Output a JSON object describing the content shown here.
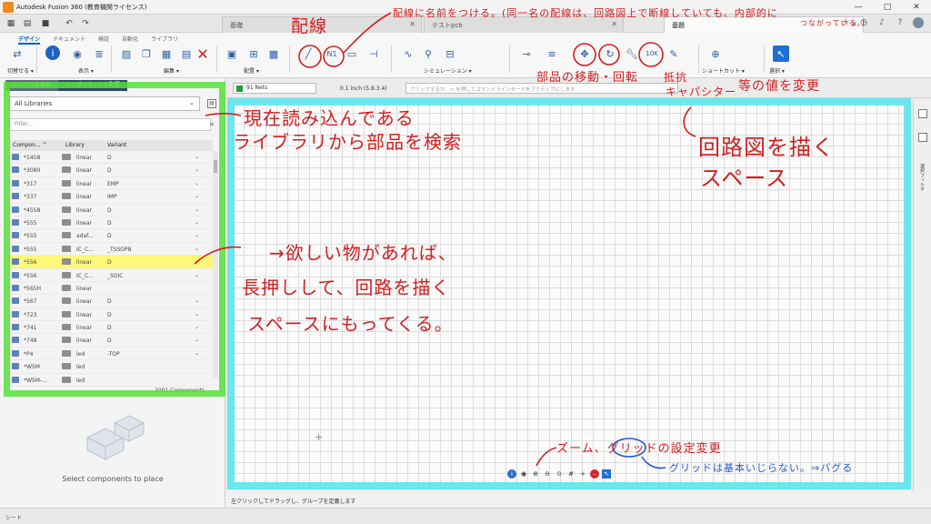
{
  "title_bar": {
    "title": "Autodesk Fusion 360 (教育機関ライセンス)",
    "controls": [
      "—",
      "□",
      "✕"
    ]
  },
  "doc_tabs": [
    {
      "label": "基礎",
      "active": false
    },
    {
      "label": "テストpcb",
      "active": false
    },
    {
      "label": "基題",
      "active": true
    }
  ],
  "ribbon": {
    "tabs": [
      "デザイン",
      "ドキュメント",
      "検証",
      "自動化",
      "ライブラリ"
    ],
    "groups": [
      "切替せる ▾",
      "表示 ▾",
      "編集 ▾",
      "配置 ▾",
      "シミュレーション ▾",
      "ショートカット ▾",
      "選択 ▾"
    ]
  },
  "left_panel": {
    "tabs": [
      "レイヤーを表示",
      "コンポーネントを配置"
    ],
    "library_select": "All Libraries",
    "filter_placeholder": "Filter...",
    "columns": {
      "component": "Compon... ^",
      "library": "Library",
      "variant": "Variant"
    },
    "rows": [
      {
        "component": "*1458",
        "library": "linear",
        "variant": "D",
        "highlight": false
      },
      {
        "component": "*3080",
        "library": "linear",
        "variant": "D",
        "highlight": false
      },
      {
        "component": "*317",
        "library": "linear",
        "variant": "EMP",
        "highlight": false
      },
      {
        "component": "*337",
        "library": "linear",
        "variant": "IMP",
        "highlight": false
      },
      {
        "component": "*4558",
        "library": "linear",
        "variant": "D",
        "highlight": false
      },
      {
        "component": "*555",
        "library": "linear",
        "variant": "D",
        "highlight": false
      },
      {
        "component": "*555",
        "library": "adaf...",
        "variant": "D",
        "highlight": false
      },
      {
        "component": "*555",
        "library": "IC_C...",
        "variant": "_TSSOP8",
        "highlight": false
      },
      {
        "component": "*556",
        "library": "linear",
        "variant": "D",
        "highlight": true
      },
      {
        "component": "*556",
        "library": "IC_C...",
        "variant": "_SOIC",
        "highlight": false
      },
      {
        "component": "*565H",
        "library": "linear",
        "variant": "",
        "highlight": false
      },
      {
        "component": "*567",
        "library": "linear",
        "variant": "D",
        "highlight": false
      },
      {
        "component": "*723",
        "library": "linear",
        "variant": "D",
        "highlight": false
      },
      {
        "component": "*741",
        "library": "linear",
        "variant": "D",
        "highlight": false
      },
      {
        "component": "*748",
        "library": "linear",
        "variant": "D",
        "highlight": false
      },
      {
        "component": "*P4",
        "library": "led",
        "variant": "-TOP",
        "highlight": false
      },
      {
        "component": "*W5M",
        "library": "led",
        "variant": "",
        "highlight": false
      },
      {
        "component": "*W5M-...",
        "library": "led",
        "variant": "",
        "highlight": false
      }
    ],
    "count": "2001 Components",
    "empty_text": "Select components to place"
  },
  "canvas_toolbar": {
    "nets": "91 Nets",
    "grid_size": "0.1 inch (5.8.3.4)",
    "command_placeholder": "クリックするか、> を押してコマンドラインモードをアクティブにします"
  },
  "right_strip": {
    "label": "選択フィルタ"
  },
  "hint_text": "左クリックしてドラッグし、グループを定義します",
  "bottom_text": "シート",
  "annotations": {
    "wire": "配線",
    "net_name": "配線に名前をつける。(同一名の配線は、回路図上で断線していても、内部的に",
    "net_name2": "つながっている。)",
    "move_rotate": "部品の移動・回転",
    "resistor": "抵抗",
    "capacitor": "キャパシター",
    "value": "等の値を変更",
    "library_search1": "現在読み込んである",
    "library_search2": "ライブラリから部品を検索",
    "drawing_space1": "回路図を描く",
    "drawing_space2": "スペース",
    "drag1": "→欲しい物があれば、",
    "drag2": "長押しして、回路を描く",
    "drag3": "スペースにもってくる。",
    "zoom_grid": "ズーム、グリッドの設定変更",
    "grid_note": "グリッドは基本いじらない。⇒バグる"
  },
  "colors": {
    "accent": "#0a62c4",
    "annotation_red": "#d21f1f",
    "annotation_blue": "#1f56d6",
    "highlight_green": "#55e036",
    "highlight_cyan": "#54e5ec"
  }
}
